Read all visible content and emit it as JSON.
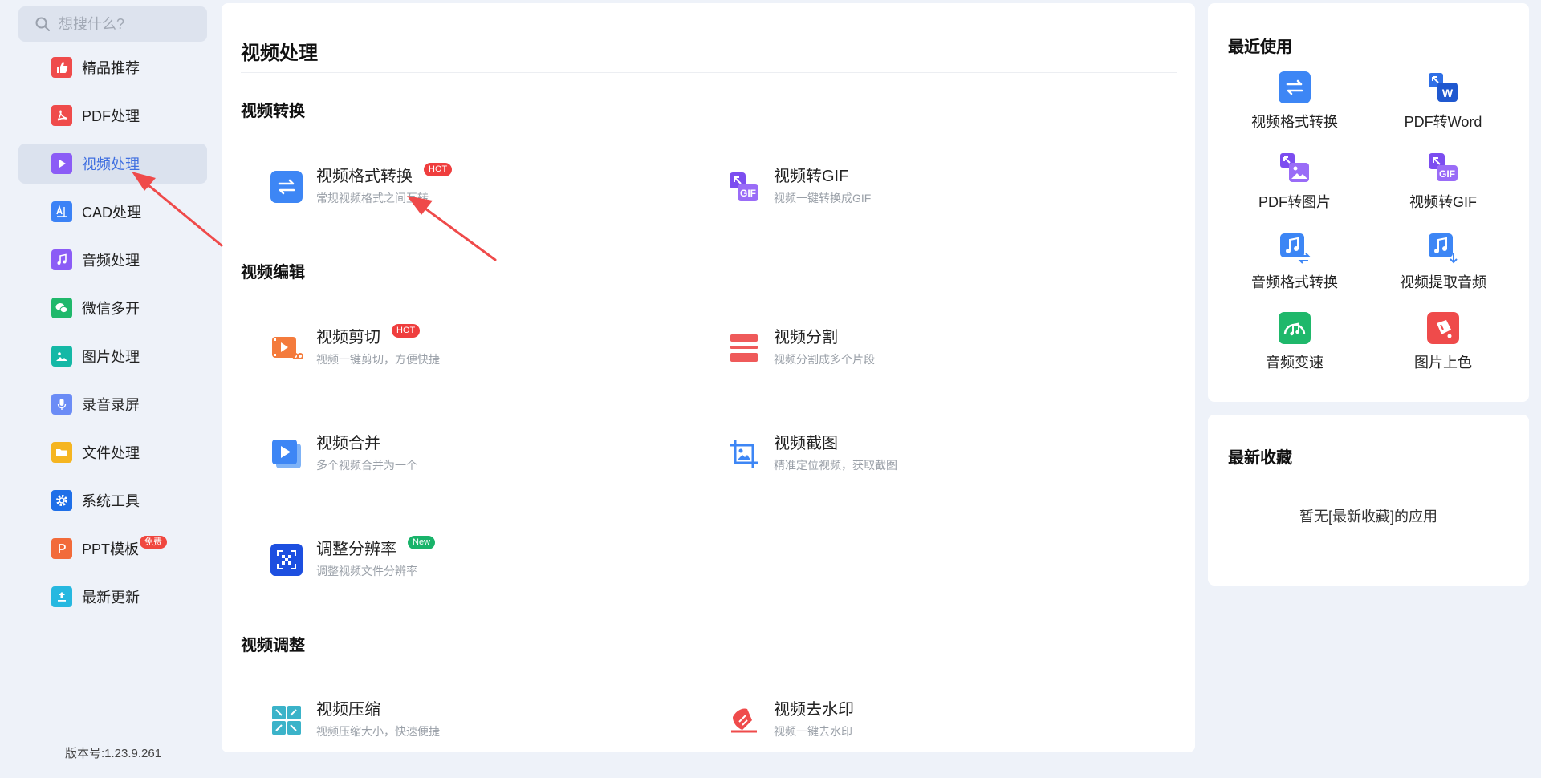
{
  "search": {
    "placeholder": "想搜什么?"
  },
  "sidebar": {
    "items": [
      {
        "label": "精品推荐",
        "icon": "thumbs-up-icon",
        "color": "#ef4b4b"
      },
      {
        "label": "PDF处理",
        "icon": "pdf-icon",
        "color": "#ef4b4b"
      },
      {
        "label": "视频处理",
        "icon": "play-icon",
        "color": "#8b5cf6",
        "active": true
      },
      {
        "label": "CAD处理",
        "icon": "cad-icon",
        "color": "#3b82f6"
      },
      {
        "label": "音频处理",
        "icon": "music-icon",
        "color": "#8b5cf6"
      },
      {
        "label": "微信多开",
        "icon": "wechat-icon",
        "color": "#1fb86b"
      },
      {
        "label": "图片处理",
        "icon": "image-icon",
        "color": "#14b8a6"
      },
      {
        "label": "录音录屏",
        "icon": "microphone-icon",
        "color": "#6b8cf6"
      },
      {
        "label": "文件处理",
        "icon": "folder-icon",
        "color": "#f5b521"
      },
      {
        "label": "系统工具",
        "icon": "gear-icon",
        "color": "#1e6fe8"
      },
      {
        "label": "PPT模板",
        "icon": "ppt-icon",
        "color": "#f26b3a",
        "badge": "免费"
      },
      {
        "label": "最新更新",
        "icon": "upload-icon",
        "color": "#26b8e0"
      }
    ],
    "version": "版本号:1.23.9.261"
  },
  "main": {
    "title": "视频处理",
    "sections": [
      {
        "title": "视频转换",
        "tools": [
          {
            "name": "视频格式转换",
            "desc": "常规视频格式之间互转",
            "tag": "HOT",
            "icon": "convert-arrows-icon"
          },
          {
            "name": "视频转GIF",
            "desc": "视频一键转换成GIF",
            "icon": "gif-icon"
          }
        ]
      },
      {
        "title": "视频编辑",
        "tools": [
          {
            "name": "视频剪切",
            "desc": "视频一键剪切，方便快捷",
            "tag": "HOT",
            "icon": "video-cut-icon"
          },
          {
            "name": "视频分割",
            "desc": "视频分割成多个片段",
            "icon": "split-icon"
          },
          {
            "name": "视频合并",
            "desc": "多个视频合并为一个",
            "icon": "merge-icon"
          },
          {
            "name": "视频截图",
            "desc": "精准定位视频，获取截图",
            "icon": "crop-icon"
          },
          {
            "name": "调整分辨率",
            "desc": "调整视频文件分辨率",
            "tag": "New",
            "icon": "resolution-icon"
          }
        ]
      },
      {
        "title": "视频调整",
        "tools": [
          {
            "name": "视频压缩",
            "desc": "视频压缩大小，快速便捷",
            "icon": "compress-icon"
          },
          {
            "name": "视频去水印",
            "desc": "视频一键去水印",
            "icon": "watermark-icon"
          }
        ]
      }
    ]
  },
  "recent": {
    "title": "最近使用",
    "items": [
      {
        "label": "视频格式转换",
        "icon": "convert-arrows-icon"
      },
      {
        "label": "PDF转Word",
        "icon": "pdf-to-word-icon"
      },
      {
        "label": "PDF转图片",
        "icon": "pdf-to-image-icon"
      },
      {
        "label": "视频转GIF",
        "icon": "gif-icon"
      },
      {
        "label": "音频格式转换",
        "icon": "audio-convert-icon"
      },
      {
        "label": "视频提取音频",
        "icon": "extract-audio-icon"
      },
      {
        "label": "音频变速",
        "icon": "audio-speed-icon"
      },
      {
        "label": "图片上色",
        "icon": "colorize-icon"
      }
    ]
  },
  "favorites": {
    "title": "最新收藏",
    "empty_text": "暂无[最新收藏]的应用"
  }
}
